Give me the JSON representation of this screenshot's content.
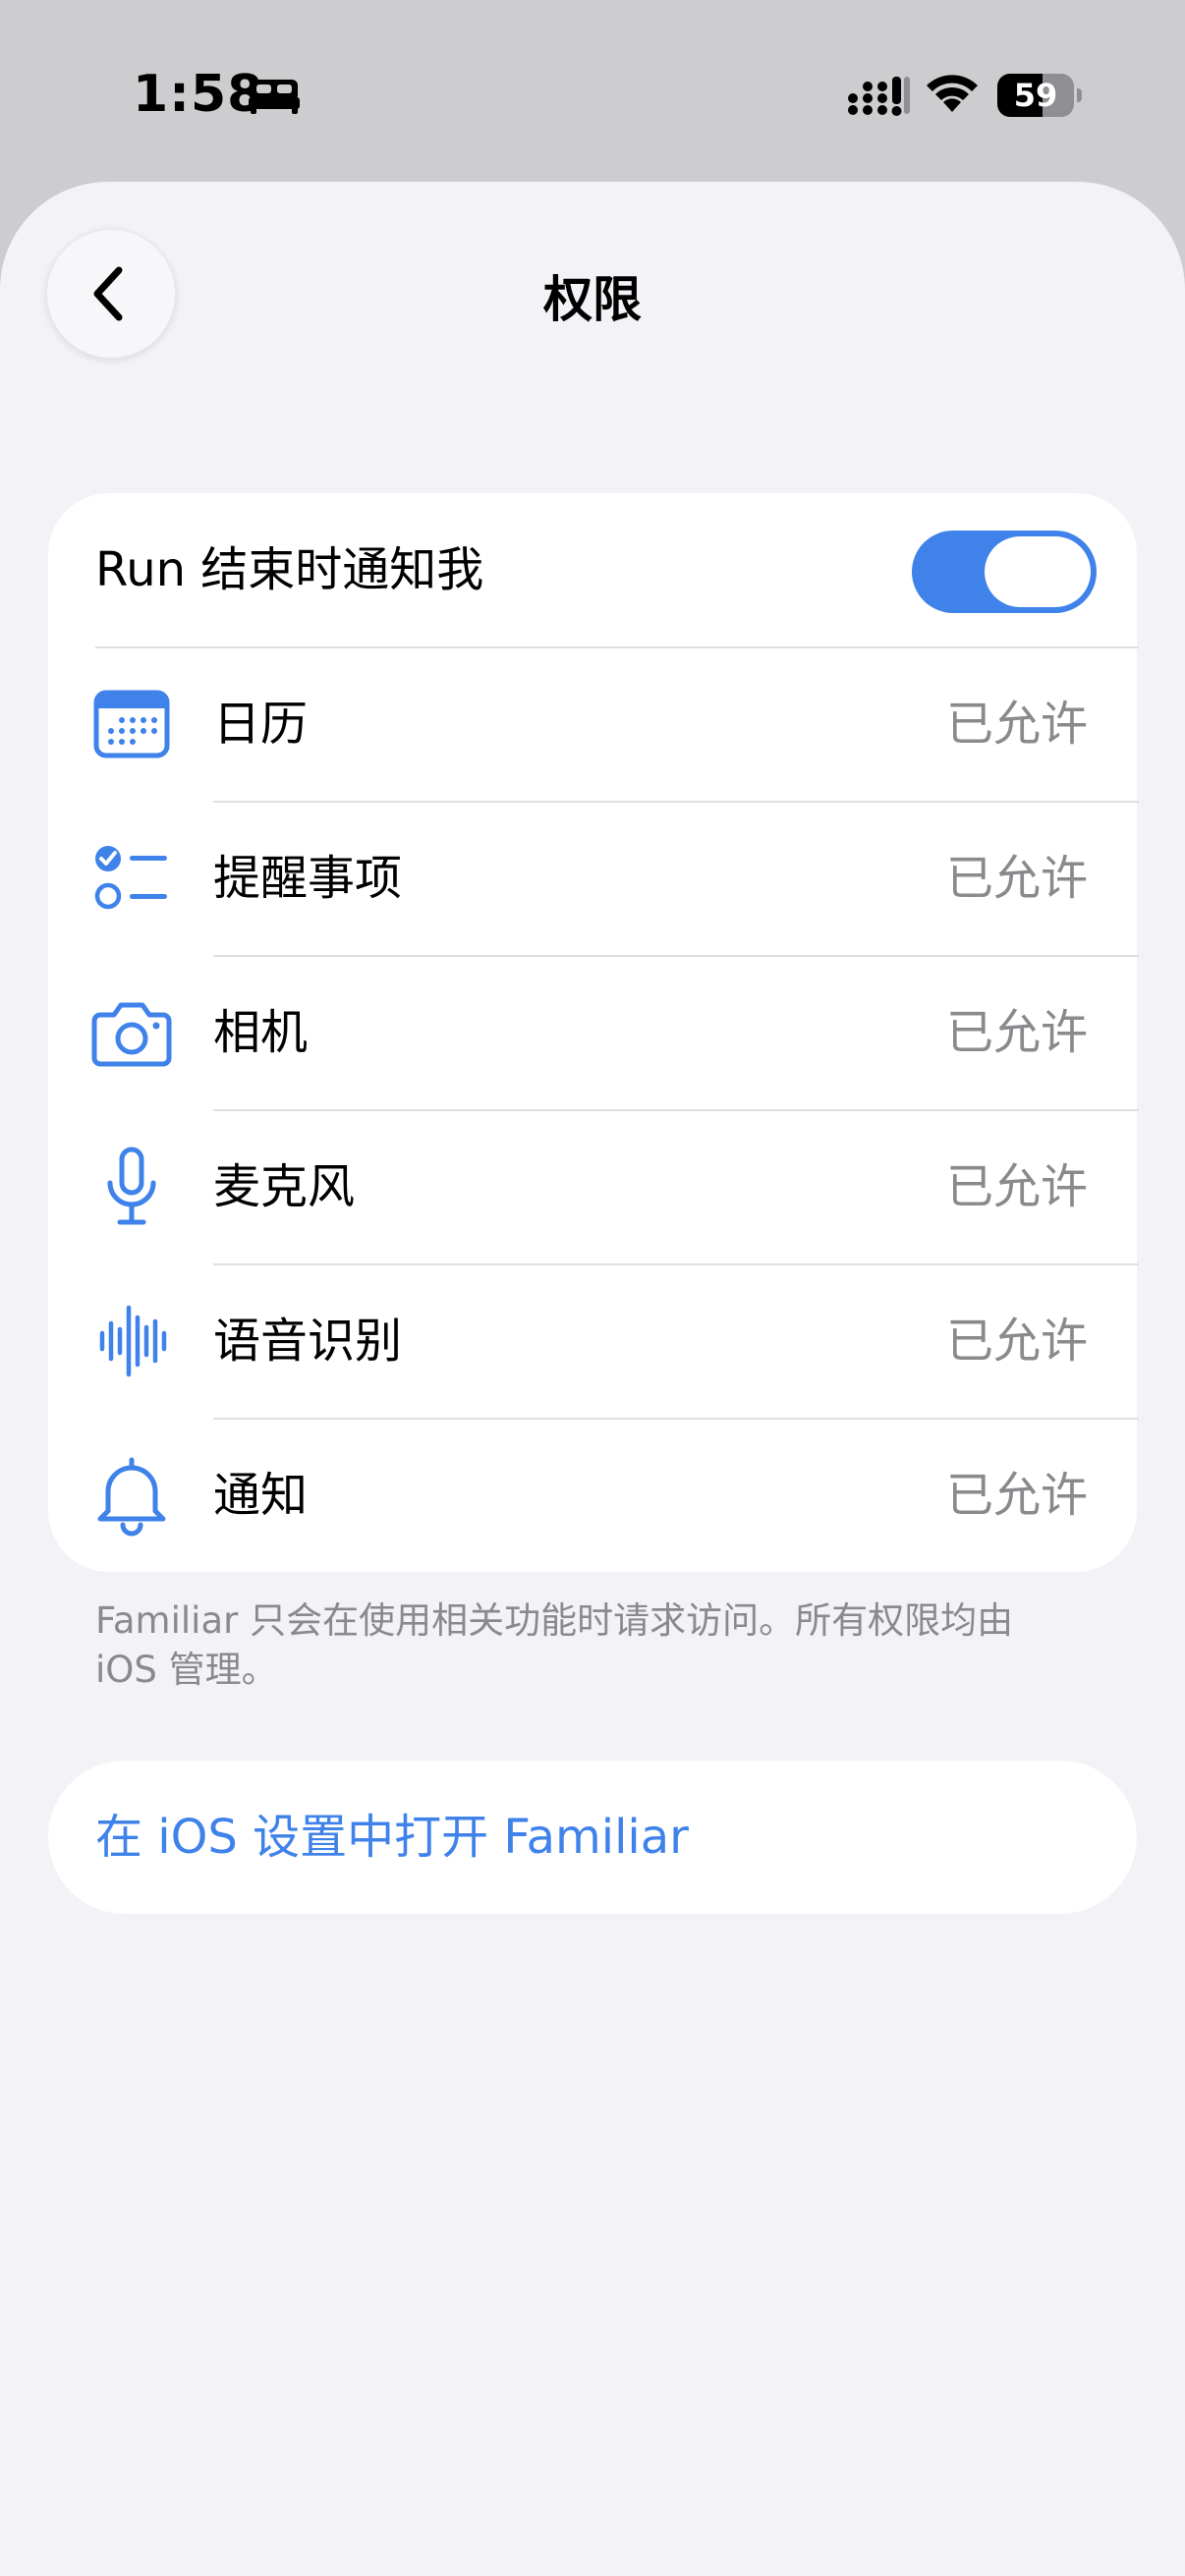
{
  "status_bar": {
    "time": "1:58",
    "battery": "59",
    "battery_level": 0.59
  },
  "header": {
    "title": "权限"
  },
  "colors": {
    "accent": "#3f82ea",
    "secondary_text": "#8a8a8e"
  },
  "toggle_row": {
    "label": "Run 结束时通知我",
    "enabled": true
  },
  "permissions": [
    {
      "icon": "calendar-icon",
      "label": "日历",
      "status": "已允许"
    },
    {
      "icon": "reminders-icon",
      "label": "提醒事项",
      "status": "已允许"
    },
    {
      "icon": "camera-icon",
      "label": "相机",
      "status": "已允许"
    },
    {
      "icon": "microphone-icon",
      "label": "麦克风",
      "status": "已允许"
    },
    {
      "icon": "waveform-icon",
      "label": "语音识别",
      "status": "已允许"
    },
    {
      "icon": "bell-icon",
      "label": "通知",
      "status": "已允许"
    }
  ],
  "footnote": {
    "line1": "Familiar 只会在使用相关功能时请求访问。所有权限均由",
    "line2": "iOS 管理。"
  },
  "open_settings": {
    "label": "在 iOS 设置中打开 Familiar"
  }
}
